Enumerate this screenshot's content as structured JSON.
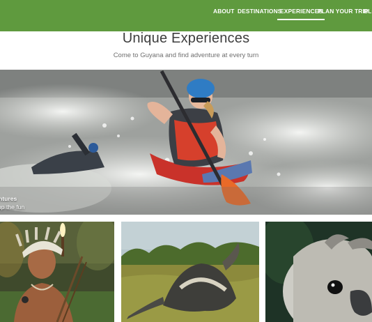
{
  "nav": {
    "items": [
      {
        "label": "ABOUT",
        "active": false
      },
      {
        "label": "DESTINATIONS",
        "active": false
      },
      {
        "label": "EXPERIENCES",
        "active": true
      },
      {
        "label": "PLAN YOUR TRIP",
        "active": false
      },
      {
        "label": "BLO",
        "active": false
      }
    ]
  },
  "hero": {
    "title": "Unique Experiences",
    "subtitle": "Come to Guyana and find adventure at every turn"
  },
  "banner": {
    "caption_title": "ntures",
    "caption_subtitle": "up the fun"
  },
  "colors": {
    "brand_green": "#5f9a3e",
    "heading_text": "#3d3d3d",
    "subtext": "#6f6f6f"
  }
}
